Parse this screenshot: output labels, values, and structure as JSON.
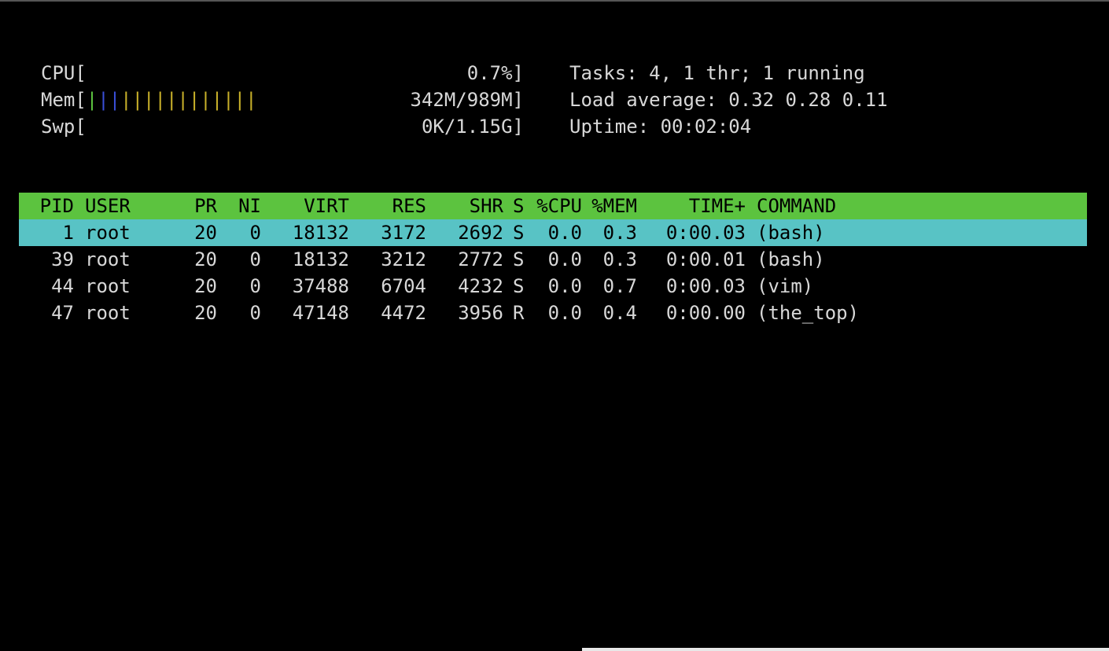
{
  "meters": {
    "cpu": {
      "label": "CPU[",
      "value": "0.7%]"
    },
    "mem": {
      "label": "Mem[",
      "value": "342M/989M]",
      "bar_segments": [
        {
          "text": "|",
          "color": "#5cc33f"
        },
        {
          "text": "||",
          "color": "#3a4fd8"
        },
        {
          "text": "||||||||||||",
          "color": "#c8b02a"
        }
      ]
    },
    "swp": {
      "label": "Swp[",
      "value": "0K/1.15G]"
    }
  },
  "info": {
    "tasks": "Tasks: 4, 1 thr; 1 running",
    "load": "Load average: 0.32 0.28 0.11",
    "uptime": "Uptime: 00:02:04"
  },
  "table": {
    "headers": {
      "pid": "PID",
      "user": "USER",
      "pr": "PR",
      "ni": "NI",
      "virt": "VIRT",
      "res": "RES",
      "shr": "SHR",
      "s": "S",
      "cpu": "%CPU",
      "mem": "%MEM",
      "time": "TIME+",
      "command": "COMMAND"
    },
    "rows": [
      {
        "pid": "1",
        "user": "root",
        "pr": "20",
        "ni": "0",
        "virt": "18132",
        "res": "3172",
        "shr": "2692",
        "s": "S",
        "cpu": "0.0",
        "mem": "0.3",
        "time": "0:00.03",
        "command": "(bash)"
      },
      {
        "pid": "39",
        "user": "root",
        "pr": "20",
        "ni": "0",
        "virt": "18132",
        "res": "3212",
        "shr": "2772",
        "s": "S",
        "cpu": "0.0",
        "mem": "0.3",
        "time": "0:00.01",
        "command": "(bash)"
      },
      {
        "pid": "44",
        "user": "root",
        "pr": "20",
        "ni": "0",
        "virt": "37488",
        "res": "6704",
        "shr": "4232",
        "s": "S",
        "cpu": "0.0",
        "mem": "0.7",
        "time": "0:00.03",
        "command": "(vim)"
      },
      {
        "pid": "47",
        "user": "root",
        "pr": "20",
        "ni": "0",
        "virt": "47148",
        "res": "4472",
        "shr": "3956",
        "s": "R",
        "cpu": "0.0",
        "mem": "0.4",
        "time": "0:00.00",
        "command": "(the_top)"
      }
    ]
  },
  "colors": {
    "header_bg": "#5cc33f",
    "selected_bg": "#58c3c5",
    "text": "#d8d8d8",
    "background": "#000000"
  }
}
